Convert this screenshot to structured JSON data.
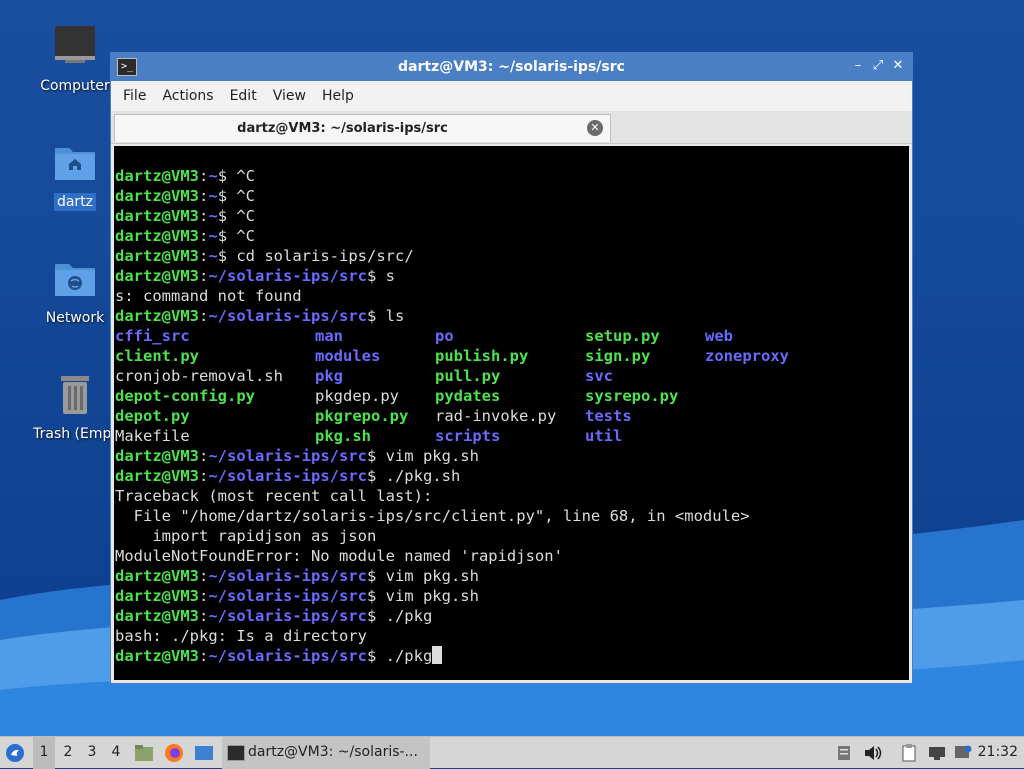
{
  "desktop": {
    "icons": [
      {
        "label": "Computer"
      },
      {
        "label": "dartz"
      },
      {
        "label": "Network"
      },
      {
        "label": "Trash (Empt"
      }
    ]
  },
  "window": {
    "title": "dartz@VM3: ~/solaris-ips/src",
    "menu": [
      "File",
      "Actions",
      "Edit",
      "View",
      "Help"
    ],
    "tab_label": "dartz@VM3: ~/solaris-ips/src"
  },
  "terminal": {
    "user_host": "dartz@VM3",
    "lines": [
      {
        "path": "~",
        "cmd": "$ ^C"
      },
      {
        "path": "~",
        "cmd": "$ ^C"
      },
      {
        "path": "~",
        "cmd": "$ ^C"
      },
      {
        "path": "~",
        "cmd": "$ ^C"
      },
      {
        "path": "~",
        "cmd": "$ cd solaris-ips/src/"
      },
      {
        "path": "~/solaris-ips/src",
        "cmd": "$ s"
      },
      {
        "out": "s: command not found"
      },
      {
        "path": "~/solaris-ips/src",
        "cmd": "$ ls"
      }
    ],
    "ls_rows": [
      [
        [
          "cffi_src",
          "dir"
        ],
        [
          "man",
          "dir"
        ],
        [
          "po",
          "dir"
        ],
        [
          "setup.py",
          "exe"
        ],
        [
          "web",
          "dir"
        ]
      ],
      [
        [
          "client.py",
          "exe"
        ],
        [
          "modules",
          "dir"
        ],
        [
          "publish.py",
          "exe"
        ],
        [
          "sign.py",
          "exe"
        ],
        [
          "zoneproxy",
          "dir"
        ]
      ],
      [
        [
          "cronjob-removal.sh",
          "plain"
        ],
        [
          "pkg",
          "dir"
        ],
        [
          "pull.py",
          "exe"
        ],
        [
          "svc",
          "dir"
        ],
        [
          "",
          ""
        ]
      ],
      [
        [
          "depot-config.py",
          "exe"
        ],
        [
          "pkgdep.py",
          "plain"
        ],
        [
          "pydates",
          "exe"
        ],
        [
          "sysrepo.py",
          "exe"
        ],
        [
          "",
          ""
        ]
      ],
      [
        [
          "depot.py",
          "exe"
        ],
        [
          "pkgrepo.py",
          "exe"
        ],
        [
          "rad-invoke.py",
          "plain"
        ],
        [
          "tests",
          "dir"
        ],
        [
          "",
          ""
        ]
      ],
      [
        [
          "Makefile",
          "plain"
        ],
        [
          "pkg.sh",
          "exe"
        ],
        [
          "scripts",
          "dir"
        ],
        [
          "util",
          "dir"
        ],
        [
          "",
          ""
        ]
      ]
    ],
    "after": [
      {
        "path": "~/solaris-ips/src",
        "cmd": "$ vim pkg.sh"
      },
      {
        "path": "~/solaris-ips/src",
        "cmd": "$ ./pkg.sh"
      },
      {
        "out": "Traceback (most recent call last):"
      },
      {
        "out": "  File \"/home/dartz/solaris-ips/src/client.py\", line 68, in <module>"
      },
      {
        "out": "    import rapidjson as json"
      },
      {
        "out": "ModuleNotFoundError: No module named 'rapidjson'"
      },
      {
        "path": "~/solaris-ips/src",
        "cmd": "$ vim pkg.sh"
      },
      {
        "path": "~/solaris-ips/src",
        "cmd": "$ vim pkg.sh"
      },
      {
        "path": "~/solaris-ips/src",
        "cmd": "$ ./pkg"
      },
      {
        "out": "bash: ./pkg: Is a directory"
      },
      {
        "path": "~/solaris-ips/src",
        "cmd": "$ ./pkg",
        "cursor": true
      }
    ]
  },
  "taskbar": {
    "workspaces": [
      "1",
      "2",
      "3",
      "4"
    ],
    "active_workspace": "1",
    "task_label": "dartz@VM3: ~/solaris-...",
    "clock": "21:32"
  },
  "colors": {
    "prompt_user": "#4ee04e",
    "prompt_path": "#6a6afc",
    "title_bar": "#4a7fc6"
  }
}
